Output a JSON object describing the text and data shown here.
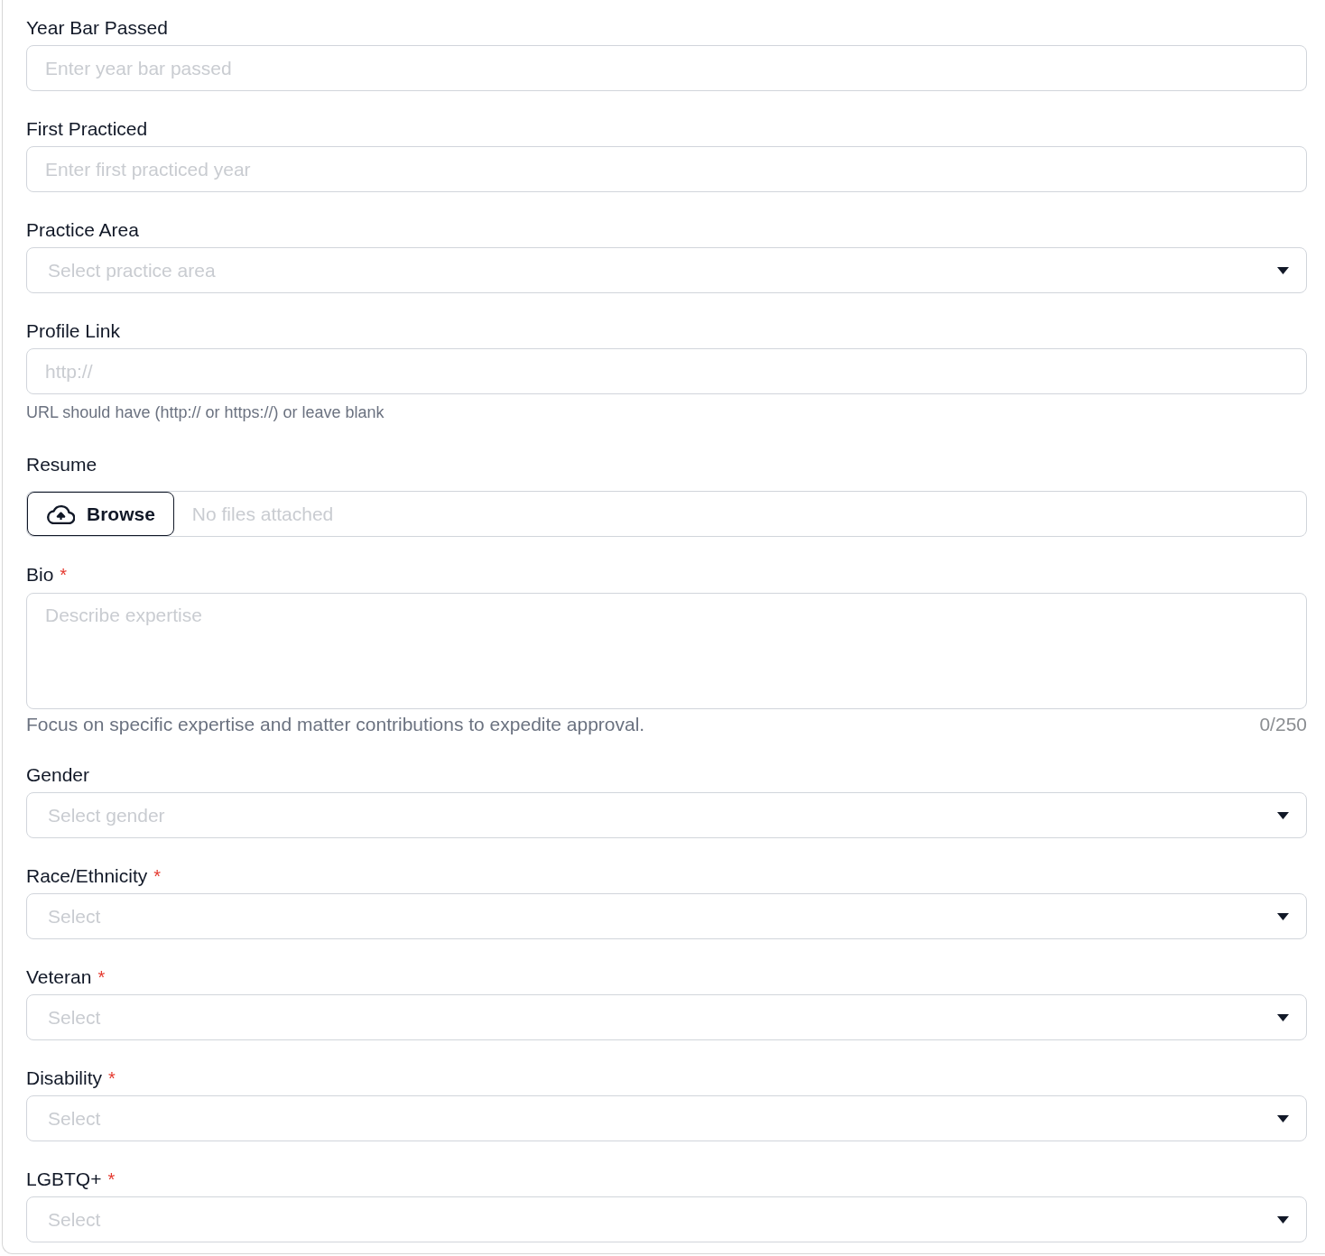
{
  "fields": [
    {
      "kind": "text",
      "label": "Year Bar Passed",
      "placeholder": "Enter year bar passed"
    },
    {
      "kind": "text",
      "label": "First Practiced",
      "placeholder": "Enter first practiced year"
    },
    {
      "kind": "select",
      "label": "Practice Area",
      "placeholder": "Select practice area"
    },
    {
      "kind": "text",
      "label": "Profile Link",
      "placeholder": "http://",
      "helper": "URL should have (http:// or https://) or leave blank"
    },
    {
      "kind": "file",
      "label": "Resume",
      "button": "Browse",
      "status": "No files attached"
    },
    {
      "kind": "textarea",
      "label": "Bio",
      "required_mark": "*",
      "placeholder": "Describe expertise",
      "helper": "Focus on specific expertise and matter contributions to expedite approval.",
      "counter": "0/250"
    },
    {
      "kind": "select",
      "label": "Gender",
      "placeholder": "Select gender"
    },
    {
      "kind": "select",
      "label": "Race/Ethnicity",
      "required_mark": "*",
      "placeholder": "Select"
    },
    {
      "kind": "select",
      "label": "Veteran",
      "required_mark": "*",
      "placeholder": "Select"
    },
    {
      "kind": "select",
      "label": "Disability",
      "required_mark": "*",
      "placeholder": "Select"
    },
    {
      "kind": "select",
      "label": "LGBTQ+",
      "required_mark": "*",
      "placeholder": "Select"
    }
  ]
}
